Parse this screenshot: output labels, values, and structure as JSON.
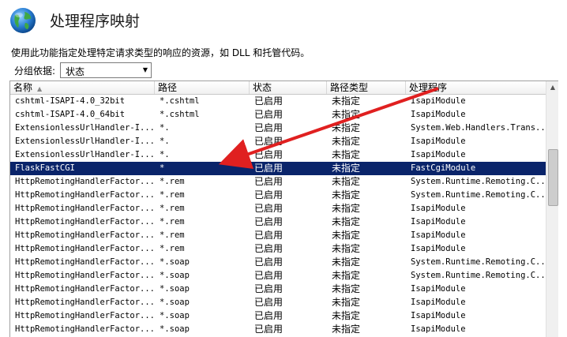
{
  "header": {
    "title": "处理程序映射",
    "icon": "globe-icon"
  },
  "description": "使用此功能指定处理特定请求类型的响应的资源，如 DLL 和托管代码。",
  "groupby": {
    "label": "分组依据:",
    "value": "状态"
  },
  "columns": [
    "名称",
    "路径",
    "状态",
    "路径类型",
    "处理程序"
  ],
  "rows": [
    {
      "name": "cshtml-ISAPI-4.0_32bit",
      "path": "*.cshtml",
      "state": "已启用",
      "type": "未指定",
      "handler": "IsapiModule"
    },
    {
      "name": "cshtml-ISAPI-4.0_64bit",
      "path": "*.cshtml",
      "state": "已启用",
      "type": "未指定",
      "handler": "IsapiModule"
    },
    {
      "name": "ExtensionlessUrlHandler-I...",
      "path": "*.",
      "state": "已启用",
      "type": "未指定",
      "handler": "System.Web.Handlers.Trans..."
    },
    {
      "name": "ExtensionlessUrlHandler-I...",
      "path": "*.",
      "state": "已启用",
      "type": "未指定",
      "handler": "IsapiModule"
    },
    {
      "name": "ExtensionlessUrlHandler-I...",
      "path": "*.",
      "state": "已启用",
      "type": "未指定",
      "handler": "IsapiModule"
    },
    {
      "name": "FlaskFastCGI",
      "path": "*",
      "state": "已启用",
      "type": "未指定",
      "handler": "FastCgiModule",
      "selected": true
    },
    {
      "name": "HttpRemotingHandlerFactor...",
      "path": "*.rem",
      "state": "已启用",
      "type": "未指定",
      "handler": "System.Runtime.Remoting.C..."
    },
    {
      "name": "HttpRemotingHandlerFactor...",
      "path": "*.rem",
      "state": "已启用",
      "type": "未指定",
      "handler": "System.Runtime.Remoting.C..."
    },
    {
      "name": "HttpRemotingHandlerFactor...",
      "path": "*.rem",
      "state": "已启用",
      "type": "未指定",
      "handler": "IsapiModule"
    },
    {
      "name": "HttpRemotingHandlerFactor...",
      "path": "*.rem",
      "state": "已启用",
      "type": "未指定",
      "handler": "IsapiModule"
    },
    {
      "name": "HttpRemotingHandlerFactor...",
      "path": "*.rem",
      "state": "已启用",
      "type": "未指定",
      "handler": "IsapiModule"
    },
    {
      "name": "HttpRemotingHandlerFactor...",
      "path": "*.rem",
      "state": "已启用",
      "type": "未指定",
      "handler": "IsapiModule"
    },
    {
      "name": "HttpRemotingHandlerFactor...",
      "path": "*.soap",
      "state": "已启用",
      "type": "未指定",
      "handler": "System.Runtime.Remoting.C..."
    },
    {
      "name": "HttpRemotingHandlerFactor...",
      "path": "*.soap",
      "state": "已启用",
      "type": "未指定",
      "handler": "System.Runtime.Remoting.C..."
    },
    {
      "name": "HttpRemotingHandlerFactor...",
      "path": "*.soap",
      "state": "已启用",
      "type": "未指定",
      "handler": "IsapiModule"
    },
    {
      "name": "HttpRemotingHandlerFactor...",
      "path": "*.soap",
      "state": "已启用",
      "type": "未指定",
      "handler": "IsapiModule"
    },
    {
      "name": "HttpRemotingHandlerFactor...",
      "path": "*.soap",
      "state": "已启用",
      "type": "未指定",
      "handler": "IsapiModule"
    },
    {
      "name": "HttpRemotingHandlerFactor...",
      "path": "*.soap",
      "state": "已启用",
      "type": "未指定",
      "handler": "IsapiModule"
    }
  ],
  "colors": {
    "selected_row": "#0a246a",
    "annotation_arrow": "#e02020"
  }
}
